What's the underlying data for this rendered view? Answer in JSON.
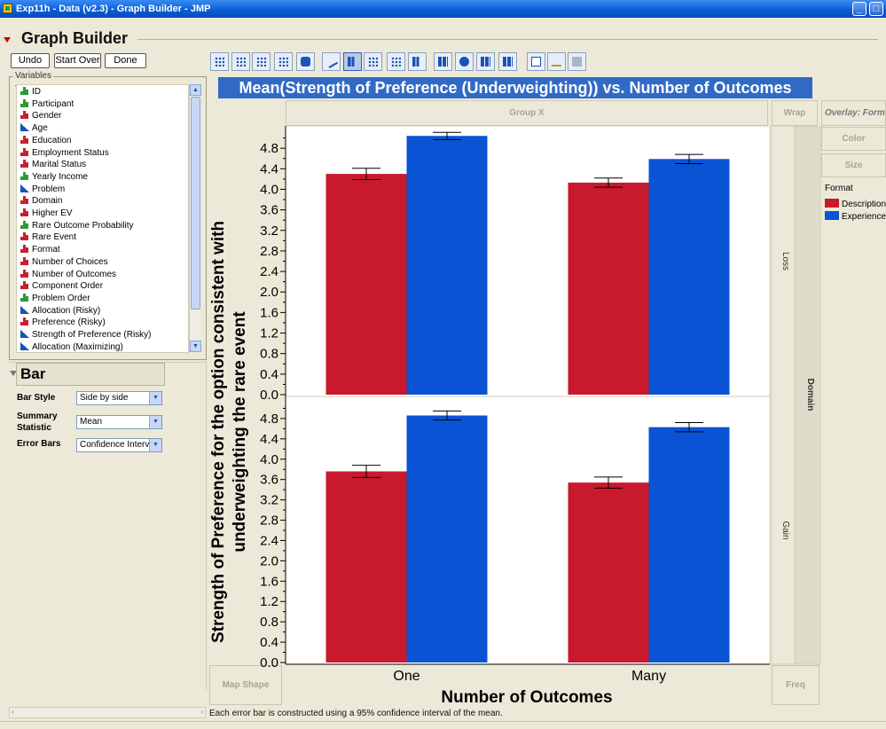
{
  "window": {
    "title": "Exp11h - Data  (v2.3) - Graph Builder - JMP",
    "minimize": "_",
    "maximize": "□"
  },
  "header": {
    "title": "Graph Builder"
  },
  "buttons": {
    "undo": "Undo",
    "start_over": "Start Over",
    "done": "Done"
  },
  "variables": {
    "label": "Variables",
    "items": [
      {
        "name": "ID",
        "type": "ordinal"
      },
      {
        "name": "Participant",
        "type": "ordinal"
      },
      {
        "name": "Gender",
        "type": "nominal"
      },
      {
        "name": "Age",
        "type": "continuous"
      },
      {
        "name": "Education",
        "type": "nominal"
      },
      {
        "name": "Employment Status",
        "type": "nominal"
      },
      {
        "name": "Marital Status",
        "type": "nominal"
      },
      {
        "name": "Yearly Income",
        "type": "ordinal"
      },
      {
        "name": "Problem",
        "type": "continuous"
      },
      {
        "name": "Domain",
        "type": "nominal"
      },
      {
        "name": "Higher EV",
        "type": "nominal"
      },
      {
        "name": "Rare Outcome Probability",
        "type": "ordinal"
      },
      {
        "name": "Rare Event",
        "type": "nominal"
      },
      {
        "name": "Format",
        "type": "nominal"
      },
      {
        "name": "Number of Choices",
        "type": "nominal"
      },
      {
        "name": "Number of Outcomes",
        "type": "nominal"
      },
      {
        "name": "Component Order",
        "type": "nominal"
      },
      {
        "name": "Problem Order",
        "type": "ordinal"
      },
      {
        "name": "Allocation (Risky)",
        "type": "continuous"
      },
      {
        "name": "Preference (Risky)",
        "type": "nominal"
      },
      {
        "name": "Strength of Preference (Risky)",
        "type": "continuous"
      },
      {
        "name": "Allocation (Maximizing)",
        "type": "continuous"
      }
    ]
  },
  "element_panel": {
    "title": "Bar",
    "bar_style_label": "Bar Style",
    "bar_style_value": "Side by side",
    "summary_label_1": "Summary",
    "summary_label_2": "Statistic",
    "summary_value": "Mean",
    "error_bars_label": "Error Bars",
    "error_bars_value": "Confidence Interval"
  },
  "zones": {
    "group_x": "Group X",
    "wrap": "Wrap",
    "overlay": "Overlay: Format",
    "color": "Color",
    "size": "Size",
    "map_shape": "Map Shape",
    "freq": "Freq",
    "group_y_title": "Domain"
  },
  "legend": {
    "title": "Format",
    "items": [
      {
        "label": "Description",
        "color": "#c8192d"
      },
      {
        "label": "Experience",
        "color": "#0a53d4"
      }
    ]
  },
  "footnote": "Each error bar is constructed using a 95% confidence interval of the mean.",
  "chart_data": {
    "type": "bar",
    "title": "Mean(Strength of Preference (Underweighting)) vs. Number of Outcomes",
    "xlabel": "Number of Outcomes",
    "ylabel_line1": "Strength of Preference for the option consistent with",
    "ylabel_line2": "underweighting the rare event",
    "categories": [
      "One",
      "Many"
    ],
    "ylim": [
      0,
      5.2
    ],
    "yticks": [
      "0.0",
      "0.4",
      "0.8",
      "1.2",
      "1.6",
      "2.0",
      "2.4",
      "2.8",
      "3.2",
      "3.6",
      "4.0",
      "4.4",
      "4.8"
    ],
    "panels": [
      {
        "name": "Loss",
        "series": [
          {
            "name": "Description",
            "values": [
              4.3,
              4.13
            ],
            "err": [
              0.11,
              0.09
            ]
          },
          {
            "name": "Experience",
            "values": [
              5.04,
              4.59
            ],
            "err": [
              0.07,
              0.09
            ]
          }
        ]
      },
      {
        "name": "Gain",
        "series": [
          {
            "name": "Description",
            "values": [
              3.76,
              3.54
            ],
            "err": [
              0.12,
              0.11
            ]
          },
          {
            "name": "Experience",
            "values": [
              4.86,
              4.63
            ],
            "err": [
              0.09,
              0.09
            ]
          }
        ]
      }
    ]
  }
}
